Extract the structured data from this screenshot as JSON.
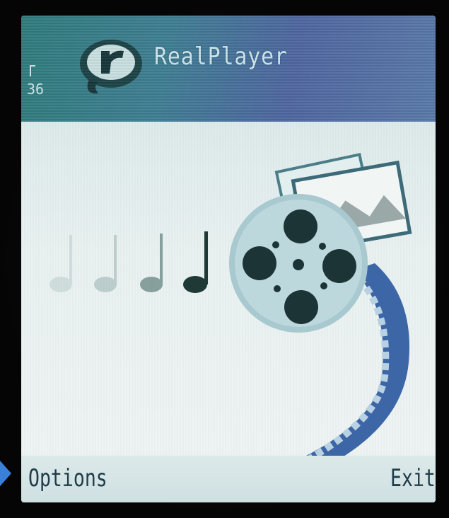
{
  "app": {
    "title": "RealPlayer"
  },
  "status": {
    "indicator": "36"
  },
  "softkeys": {
    "left": "Options",
    "right": "Exit"
  },
  "icons": {
    "logo": "realplayer-logo-icon",
    "notes": "music-notes-icon",
    "reel": "film-reel-icon",
    "photo": "picture-frame-icon",
    "filmstrip": "filmstrip-icon",
    "pointer": "arrow-pointer-icon"
  },
  "colors": {
    "header": "#3f7e93",
    "screen": "#e9f0ef",
    "softkey_text": "#1f3d4a",
    "pointer": "#3a7fd8"
  }
}
